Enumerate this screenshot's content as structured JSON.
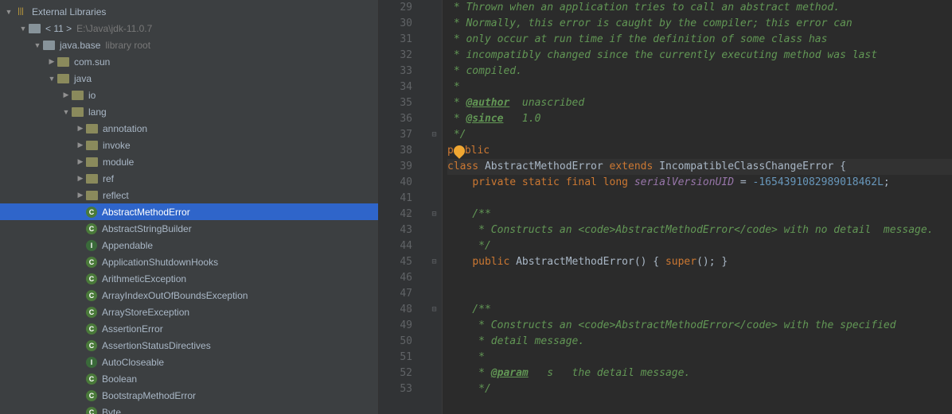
{
  "sidebar": {
    "root": "External Libraries",
    "jdk": {
      "name": "< 11 >",
      "path": "E:\\Java\\jdk-11.0.7"
    },
    "module": {
      "name": "java.base",
      "note": "library root"
    },
    "pkgs": [
      "com.sun",
      "java"
    ],
    "javaSub": [
      "io",
      "lang"
    ],
    "langSub": [
      "annotation",
      "invoke",
      "module",
      "ref",
      "reflect"
    ],
    "classes": [
      {
        "n": "AbstractMethodError",
        "k": "C",
        "sel": true
      },
      {
        "n": "AbstractStringBuilder",
        "k": "C"
      },
      {
        "n": "Appendable",
        "k": "I"
      },
      {
        "n": "ApplicationShutdownHooks",
        "k": "C"
      },
      {
        "n": "ArithmeticException",
        "k": "C"
      },
      {
        "n": "ArrayIndexOutOfBoundsException",
        "k": "C"
      },
      {
        "n": "ArrayStoreException",
        "k": "C"
      },
      {
        "n": "AssertionError",
        "k": "C"
      },
      {
        "n": "AssertionStatusDirectives",
        "k": "C"
      },
      {
        "n": "AutoCloseable",
        "k": "I"
      },
      {
        "n": "Boolean",
        "k": "C"
      },
      {
        "n": "BootstrapMethodError",
        "k": "C"
      },
      {
        "n": "Byte",
        "k": "C"
      }
    ]
  },
  "code": {
    "start": 29,
    "lines": [
      {
        "t": " * Thrown when an application tries to call an abstract method.",
        "c": "comment"
      },
      {
        "t": " * Normally, this error is caught by the compiler; this error can",
        "c": "comment"
      },
      {
        "t": " * only occur at run time if the definition of some class has",
        "c": "comment"
      },
      {
        "t": " * incompatibly changed since the currently executing method was last",
        "c": "comment"
      },
      {
        "t": " * compiled.",
        "c": "comment"
      },
      {
        "t": " *",
        "c": "comment"
      },
      {
        "pre": " * ",
        "tag": "@author",
        "post": "  unascribed",
        "c": "doctag"
      },
      {
        "pre": " * ",
        "tag": "@since",
        "post": "   1.0",
        "c": "doctag"
      },
      {
        "t": " */",
        "c": "comment",
        "fold": "close"
      },
      {
        "raw": "<span class='c-kw'>p</span><span class='bulb'></span><span class='c-kw'>blic</span>",
        "c": "raw"
      },
      {
        "raw": "<span class='c-kw'>class </span><span class='c-type'>AbstractMethodError </span><span class='c-kw'>extends </span><span class='c-type'>IncompatibleClassChangeError {</span>",
        "c": "raw",
        "hl": true
      },
      {
        "raw": "    <span class='c-kw'>private static final long </span><span class='c-field'>serialVersionUID</span> = <span class='c-num'>-1654391082989018462L</span>;",
        "c": "raw"
      },
      {
        "t": "",
        "c": "plain"
      },
      {
        "t": "    /**",
        "c": "comment",
        "fold": "open",
        "struct": true
      },
      {
        "raw": "     <span class='c-comment'>* Constructs an </span><span class='c-tag'>&lt;code&gt;</span><span class='c-comment'>AbstractMethodError</span><span class='c-tag'>&lt;/code&gt;</span><span class='c-comment'> with no detail  message.</span>",
        "c": "raw"
      },
      {
        "t": "     */",
        "c": "comment"
      },
      {
        "raw": "    <span class='c-kw'>public </span>AbstractMethodError() { <span class='c-kw'>super</span>(); }",
        "c": "raw",
        "fold": "open"
      },
      {
        "t": "",
        "c": "plain"
      },
      {
        "t": "",
        "c": "plain"
      },
      {
        "t": "    /**",
        "c": "comment",
        "fold": "open",
        "struct": true
      },
      {
        "raw": "     <span class='c-comment'>* Constructs an </span><span class='c-tag'>&lt;code&gt;</span><span class='c-comment'>AbstractMethodError</span><span class='c-tag'>&lt;/code&gt;</span><span class='c-comment'> with the specified</span>",
        "c": "raw"
      },
      {
        "t": "     * detail message.",
        "c": "comment"
      },
      {
        "t": "     *",
        "c": "comment"
      },
      {
        "pre": "     * ",
        "tag": "@param",
        "post": "   s   the detail message.",
        "c": "doctag"
      },
      {
        "t": "     */",
        "c": "comment"
      }
    ]
  }
}
